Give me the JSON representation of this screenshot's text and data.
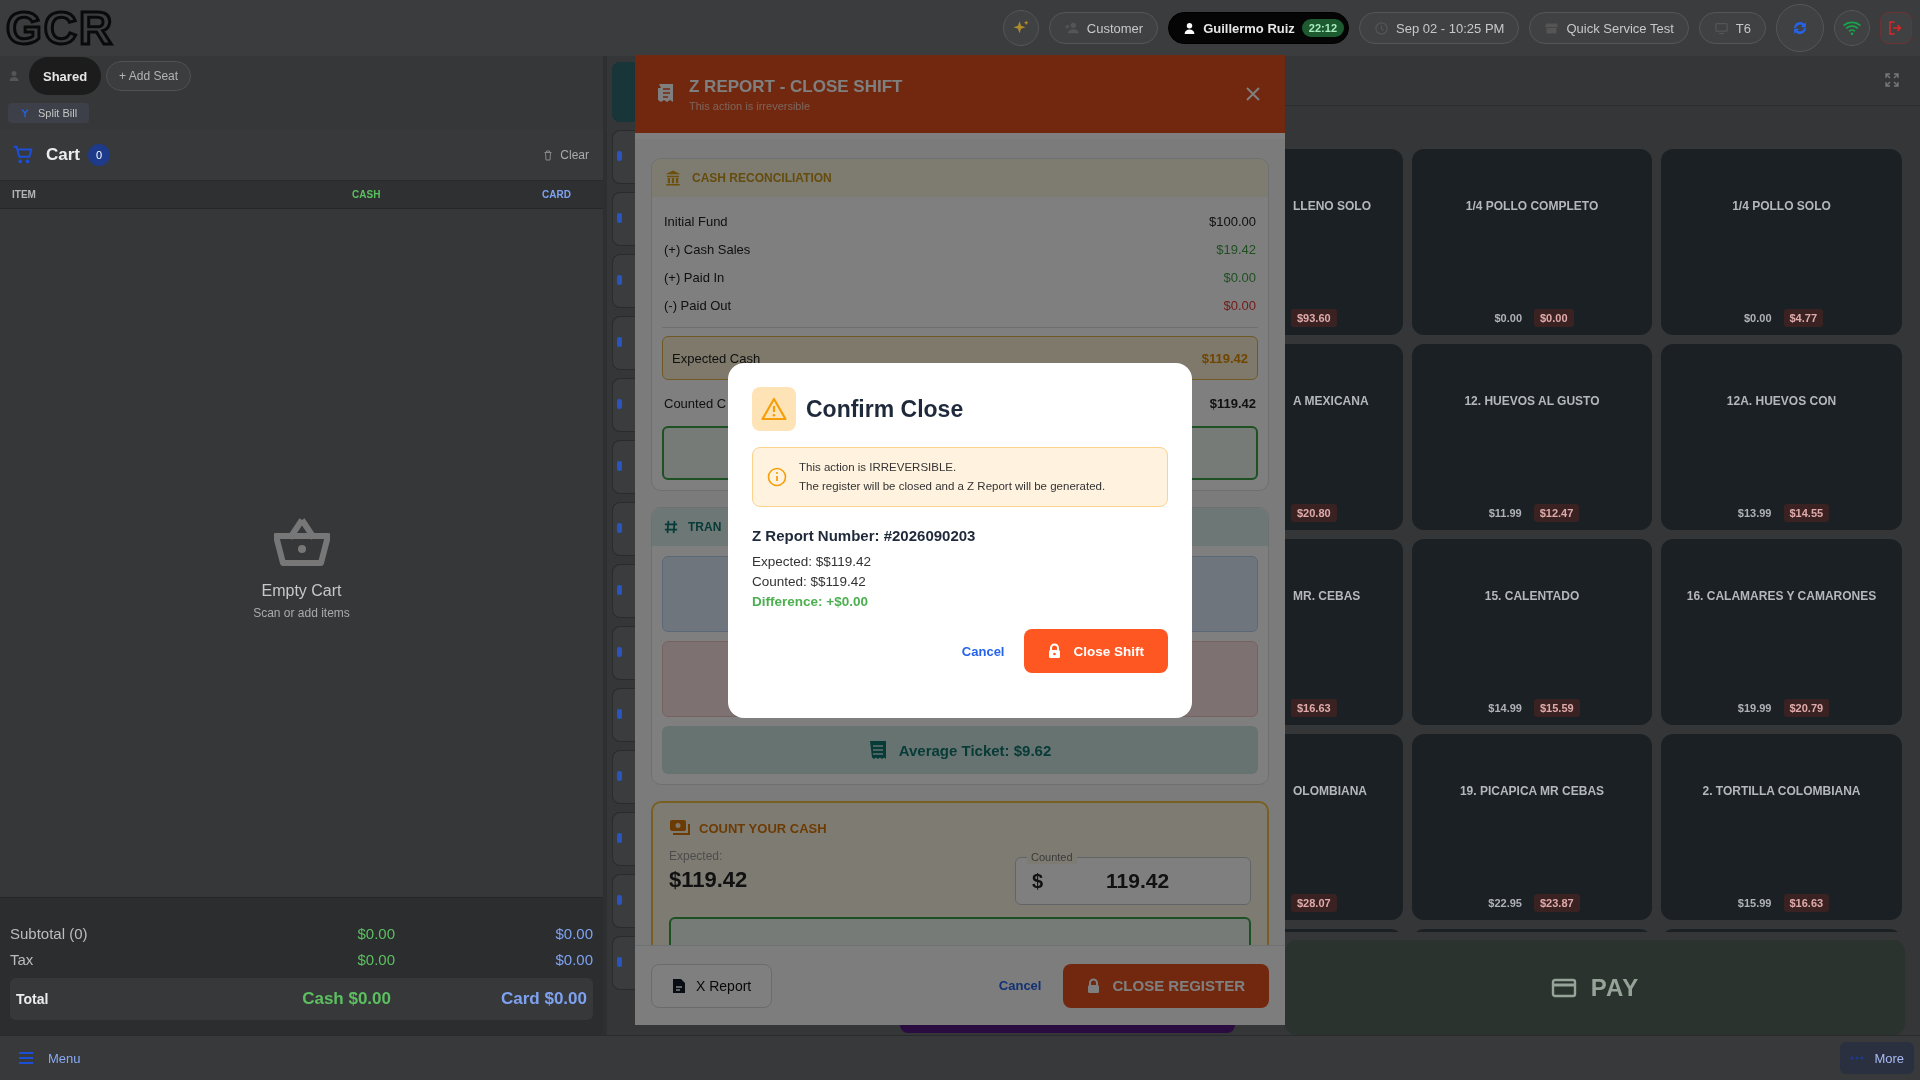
{
  "logo": "GCR",
  "top_bar": {
    "customer": "Customer",
    "user": {
      "name": "Guillermo Ruiz",
      "badge": "22:12"
    },
    "datetime": "Sep 02 - 10:25 PM",
    "store": "Quick Service Test",
    "terminal": "T6"
  },
  "seats": [
    {
      "label": "Shared",
      "selected": true
    }
  ],
  "add_seat": "+ Add Seat",
  "split_bill": "Split Bill",
  "cart": {
    "title": "Cart",
    "count": "0",
    "clear": "Clear",
    "columns": [
      "ITEM",
      "CASH",
      "CARD"
    ],
    "empty_title": "Empty Cart",
    "empty_hint": "Scan or add items",
    "totals": [
      {
        "label": "Subtotal (0)",
        "cash": "$0.00",
        "card": "$0.00"
      },
      {
        "label": "Tax",
        "cash": "$0.00",
        "card": "$0.00"
      }
    ],
    "total": {
      "label": "Total",
      "cash": "Cash $0.00",
      "card": "Card $0.00"
    }
  },
  "products": [
    {
      "name": "LLENO SOLO",
      "card": "$93.60",
      "clipped": true
    },
    {
      "name": "1/4 POLLO COMPLETO",
      "cash": "$0.00",
      "card": "$0.00",
      "clipped": false
    },
    {
      "name": "1/4 POLLO SOLO",
      "cash": "$0.00",
      "card": "$4.77",
      "clipped": false
    },
    {
      "name": "A MEXICANA",
      "card": "$20.80",
      "clipped": true
    },
    {
      "name": "12. HUEVOS AL GUSTO",
      "cash": "$11.99",
      "card": "$12.47",
      "clipped": false
    },
    {
      "name": "12A. HUEVOS CON",
      "cash": "$13.99",
      "card": "$14.55",
      "clipped": false
    },
    {
      "name": "MR. CEBAS",
      "card": "$16.63",
      "clipped": true
    },
    {
      "name": "15. CALENTADO",
      "cash": "$14.99",
      "card": "$15.59",
      "clipped": false
    },
    {
      "name": "16. CALAMARES Y CAMARONES",
      "cash": "$19.99",
      "card": "$20.79",
      "clipped": false
    },
    {
      "name": "OLOMBIANA",
      "card": "$28.07",
      "clipped": true
    },
    {
      "name": "19. PICAPICA MR CEBAS",
      "cash": "$22.95",
      "card": "$23.87",
      "clipped": false
    },
    {
      "name": "2. TORTILLA COLOMBIANA",
      "cash": "$15.99",
      "card": "$16.63",
      "clipped": false
    }
  ],
  "pay": "PAY",
  "bottom_bar": {
    "menu": "Menu",
    "more": "More"
  },
  "z_report": {
    "title": "Z REPORT - CLOSE SHIFT",
    "subtitle": "This action is irreversible",
    "reconciliation": {
      "title": "CASH RECONCILIATION",
      "rows": [
        {
          "label": "Initial Fund",
          "value": "$100.00",
          "kind": "neutral"
        },
        {
          "label": "(+) Cash Sales",
          "value": "$19.42",
          "kind": "positive"
        },
        {
          "label": "(+) Paid In",
          "value": "$0.00",
          "kind": "positive"
        },
        {
          "label": "(-) Paid Out",
          "value": "$0.00",
          "kind": "negative"
        }
      ],
      "expected": {
        "label": "Expected Cash",
        "value": "$119.42"
      },
      "counted": {
        "label": "Counted C",
        "value": "$119.42"
      }
    },
    "transactions": {
      "title": "TRAN",
      "average": "Average Ticket: $9.62"
    },
    "count": {
      "title": "COUNT YOUR CASH",
      "expected_label": "Expected:",
      "expected_value": "$119.42",
      "field_label": "Counted",
      "currency": "$",
      "value": "119.42"
    },
    "footer": {
      "x_report": "X Report",
      "cancel": "Cancel",
      "close": "CLOSE REGISTER"
    }
  },
  "confirm": {
    "title": "Confirm Close",
    "alert": [
      "This action is IRREVERSIBLE.",
      "The register will be closed and a Z Report will be generated."
    ],
    "report_number": "Z Report Number: #2026090203",
    "lines": [
      "Expected: $$119.42",
      "Counted: $$119.42"
    ],
    "difference": "Difference: +$0.00",
    "cancel": "Cancel",
    "confirm": "Close Shift"
  }
}
